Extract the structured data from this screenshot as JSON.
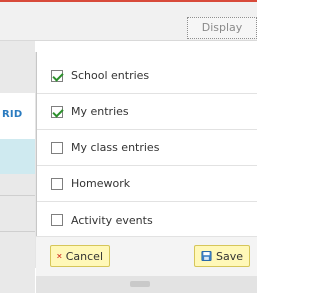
{
  "toolbar": {
    "display_button": "Display"
  },
  "left_partial": {
    "cut_text": "RID"
  },
  "menu": {
    "items": [
      {
        "label": "School entries",
        "checked": true
      },
      {
        "label": "My entries",
        "checked": true
      },
      {
        "label": "My class entries",
        "checked": false
      },
      {
        "label": "Homework",
        "checked": false
      },
      {
        "label": "Activity events",
        "checked": false
      }
    ],
    "buttons": {
      "cancel": "Cancel",
      "save": "Save"
    }
  },
  "colors": {
    "accent_red": "#d84a3a",
    "checkbox_check": "#2b8f2b",
    "button_bg": "#fff8b8",
    "button_border": "#d6c65a",
    "left_link_blue": "#2a7bc0",
    "left_band_blue": "#cfeaf0"
  },
  "icons": {
    "cancel": "close-x-icon",
    "save": "save-floppy-icon"
  }
}
